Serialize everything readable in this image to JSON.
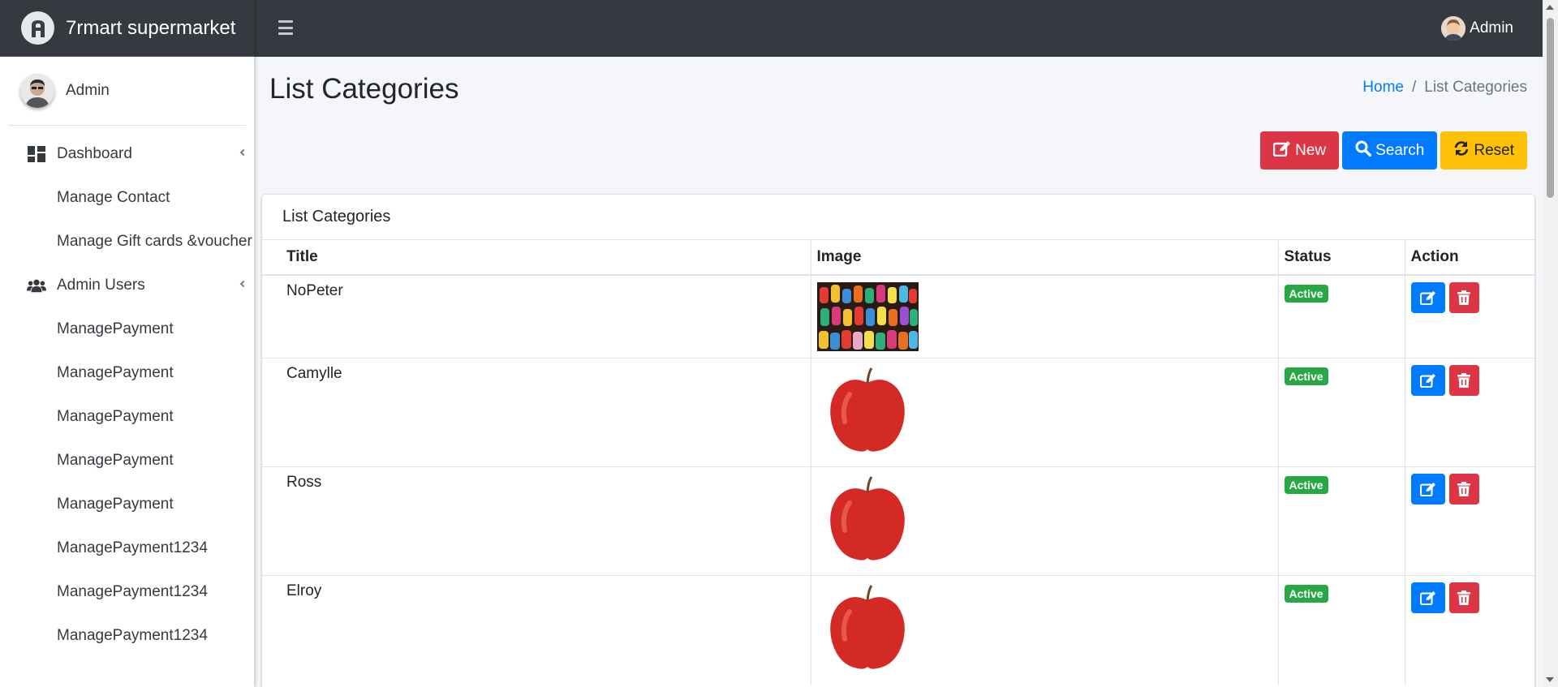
{
  "brand": {
    "title": "7rmart supermarket"
  },
  "topbar": {
    "user_label": "Admin"
  },
  "sidebar": {
    "user_name": "Admin",
    "items": [
      {
        "label": "Dashboard",
        "icon": "dashboard-icon",
        "type": "parent"
      },
      {
        "label": "Manage Contact",
        "type": "child"
      },
      {
        "label": "Manage Gift cards &voucher",
        "type": "child"
      },
      {
        "label": "Admin Users",
        "icon": "users-icon",
        "type": "parent"
      },
      {
        "label": "ManagePayment",
        "type": "child"
      },
      {
        "label": "ManagePayment",
        "type": "child"
      },
      {
        "label": "ManagePayment",
        "type": "child"
      },
      {
        "label": "ManagePayment",
        "type": "child"
      },
      {
        "label": "ManagePayment",
        "type": "child"
      },
      {
        "label": "ManagePayment1234",
        "type": "child"
      },
      {
        "label": "ManagePayment1234",
        "type": "child"
      },
      {
        "label": "ManagePayment1234",
        "type": "child"
      }
    ]
  },
  "page": {
    "title": "List Categories"
  },
  "breadcrumb": {
    "home": "Home",
    "separator": "/",
    "current": "List Categories"
  },
  "actions": {
    "new_label": "New",
    "search_label": "Search",
    "reset_label": "Reset"
  },
  "card": {
    "title": "List Categories"
  },
  "table": {
    "headers": [
      "Title",
      "Image",
      "Status",
      "Action"
    ],
    "rows": [
      {
        "title": "NoPeter",
        "image": "lanterns-image",
        "status": "Active"
      },
      {
        "title": "Camylle",
        "image": "apple-image",
        "status": "Active"
      },
      {
        "title": "Ross",
        "image": "apple-image",
        "status": "Active"
      },
      {
        "title": "Elroy",
        "image": "apple-image",
        "status": "Active"
      }
    ]
  },
  "colors": {
    "primary": "#007bff",
    "danger": "#dc3545",
    "warning": "#ffc107",
    "success": "#28a745",
    "navbar": "#343a40"
  }
}
